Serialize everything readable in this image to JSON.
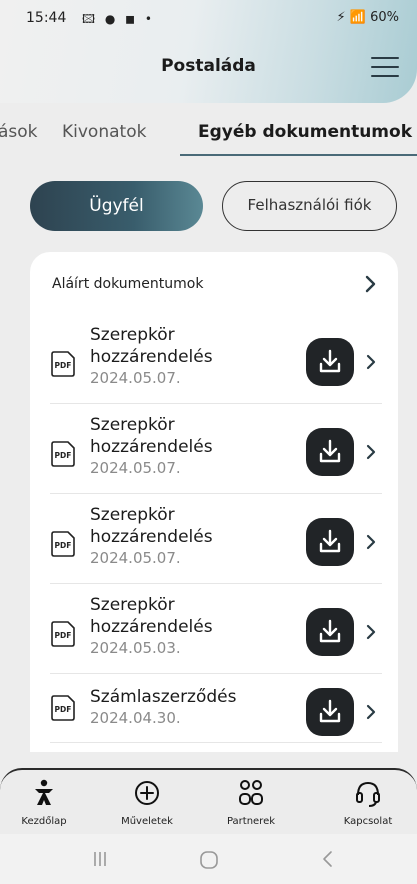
{
  "status_bar": {
    "time": "15:44",
    "left_icons": "🖾 ● ◼ •",
    "right_icons": "⚡ 📶 60%"
  },
  "header": {
    "title": "Postaláda"
  },
  "tabs": [
    {
      "label": "ások"
    },
    {
      "label": "Kivonatok"
    },
    {
      "label": "Egyéb dokumentumok",
      "active": true
    }
  ],
  "segmented": {
    "primary": "Ügyfél",
    "secondary": "Felhasználói fiók"
  },
  "card": {
    "title": "Aláírt dokumentumok",
    "documents": [
      {
        "name_line1": "Szerepkör",
        "name_line2": "hozzárendelés",
        "date": "2024.05.07."
      },
      {
        "name_line1": "Szerepkör",
        "name_line2": "hozzárendelés",
        "date": "2024.05.07."
      },
      {
        "name_line1": "Szerepkör",
        "name_line2": "hozzárendelés",
        "date": "2024.05.07."
      },
      {
        "name_line1": "Szerepkör",
        "name_line2": "hozzárendelés",
        "date": "2024.05.03."
      },
      {
        "name_line1": "Számlaszerződés",
        "name_line2": "",
        "date": "2024.04.30."
      }
    ],
    "pdf_icon_text": "PDF"
  },
  "bottom_nav": [
    {
      "label": "Kezdőlap",
      "icon": "home-person-icon"
    },
    {
      "label": "Műveletek",
      "icon": "plus-circle-icon"
    },
    {
      "label": "Partnerek",
      "icon": "partners-icon"
    },
    {
      "label": "Kapcsolat",
      "icon": "headset-icon"
    }
  ],
  "colors": {
    "accent": "#395d6c",
    "download_button": "#212427"
  }
}
